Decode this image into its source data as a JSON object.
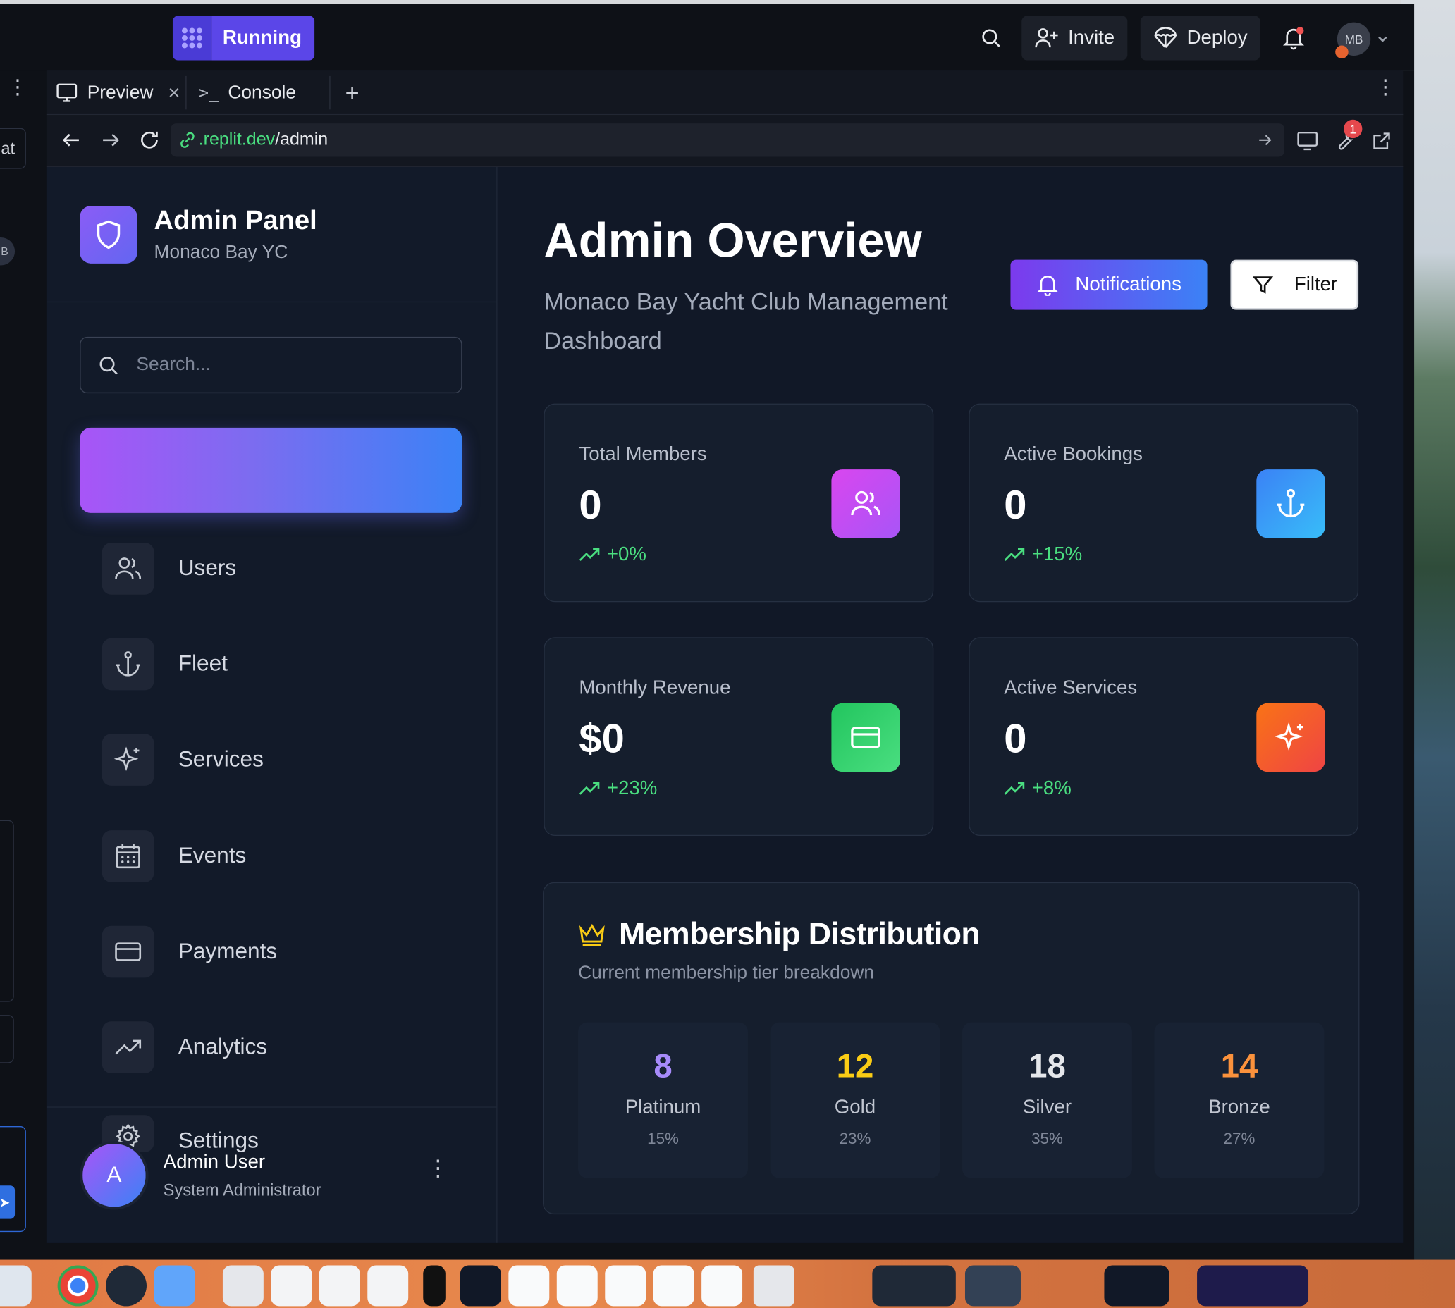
{
  "topbar": {
    "status_label": "Running",
    "invite_label": "Invite",
    "deploy_label": "Deploy",
    "avatar_initials": "MB"
  },
  "left_pane": {
    "partial_label": "at",
    "partial_badge": "B"
  },
  "tabs": [
    {
      "label": "Preview",
      "close": "×"
    },
    {
      "label": "Console"
    }
  ],
  "tab_add": "+",
  "urlbar": {
    "domain": ".replit.dev",
    "path": "/admin",
    "badge_count": "1"
  },
  "sidebar": {
    "brand_title": "Admin Panel",
    "brand_subtitle": "Monaco Bay YC",
    "search_placeholder": "Search...",
    "items": [
      {
        "label": "Users",
        "icon": "users-icon"
      },
      {
        "label": "Fleet",
        "icon": "anchor-icon"
      },
      {
        "label": "Services",
        "icon": "sparkles-icon"
      },
      {
        "label": "Events",
        "icon": "calendar-icon"
      },
      {
        "label": "Payments",
        "icon": "credit-card-icon"
      },
      {
        "label": "Analytics",
        "icon": "trending-up-icon"
      },
      {
        "label": "Settings",
        "icon": "gear-icon"
      }
    ],
    "user_initial": "A",
    "user_name": "Admin User",
    "user_role": "System Administrator"
  },
  "main": {
    "title": "Admin Overview",
    "subtitle": "Monaco Bay Yacht Club Management Dashboard",
    "notifications_label": "Notifications",
    "filter_label": "Filter",
    "stats": [
      {
        "label": "Total Members",
        "value": "0",
        "trend": "+0%",
        "icon": "users-icon",
        "color": "#d946ef"
      },
      {
        "label": "Active Bookings",
        "value": "0",
        "trend": "+15%",
        "icon": "anchor-icon",
        "color": "#3b82f6"
      },
      {
        "label": "Monthly Revenue",
        "value": "$0",
        "trend": "+23%",
        "icon": "credit-card-icon",
        "color": "#22c55e"
      },
      {
        "label": "Active Services",
        "value": "0",
        "trend": "+8%",
        "icon": "sparkles-icon",
        "color": "#f97316"
      }
    ],
    "distribution": {
      "title": "Membership Distribution",
      "subtitle": "Current membership tier breakdown",
      "tiers": [
        {
          "count": "8",
          "name": "Platinum",
          "pct": "15%",
          "color": "#a78bfa"
        },
        {
          "count": "12",
          "name": "Gold",
          "pct": "23%",
          "color": "#facc15"
        },
        {
          "count": "18",
          "name": "Silver",
          "pct": "35%",
          "color": "#e5e7eb"
        },
        {
          "count": "14",
          "name": "Bronze",
          "pct": "27%",
          "color": "#fb923c"
        }
      ]
    }
  },
  "colors": {
    "accent_purple": "#8b5cf6",
    "accent_blue": "#3b82f6",
    "trend_green": "#4ade80",
    "background": "#111827"
  }
}
